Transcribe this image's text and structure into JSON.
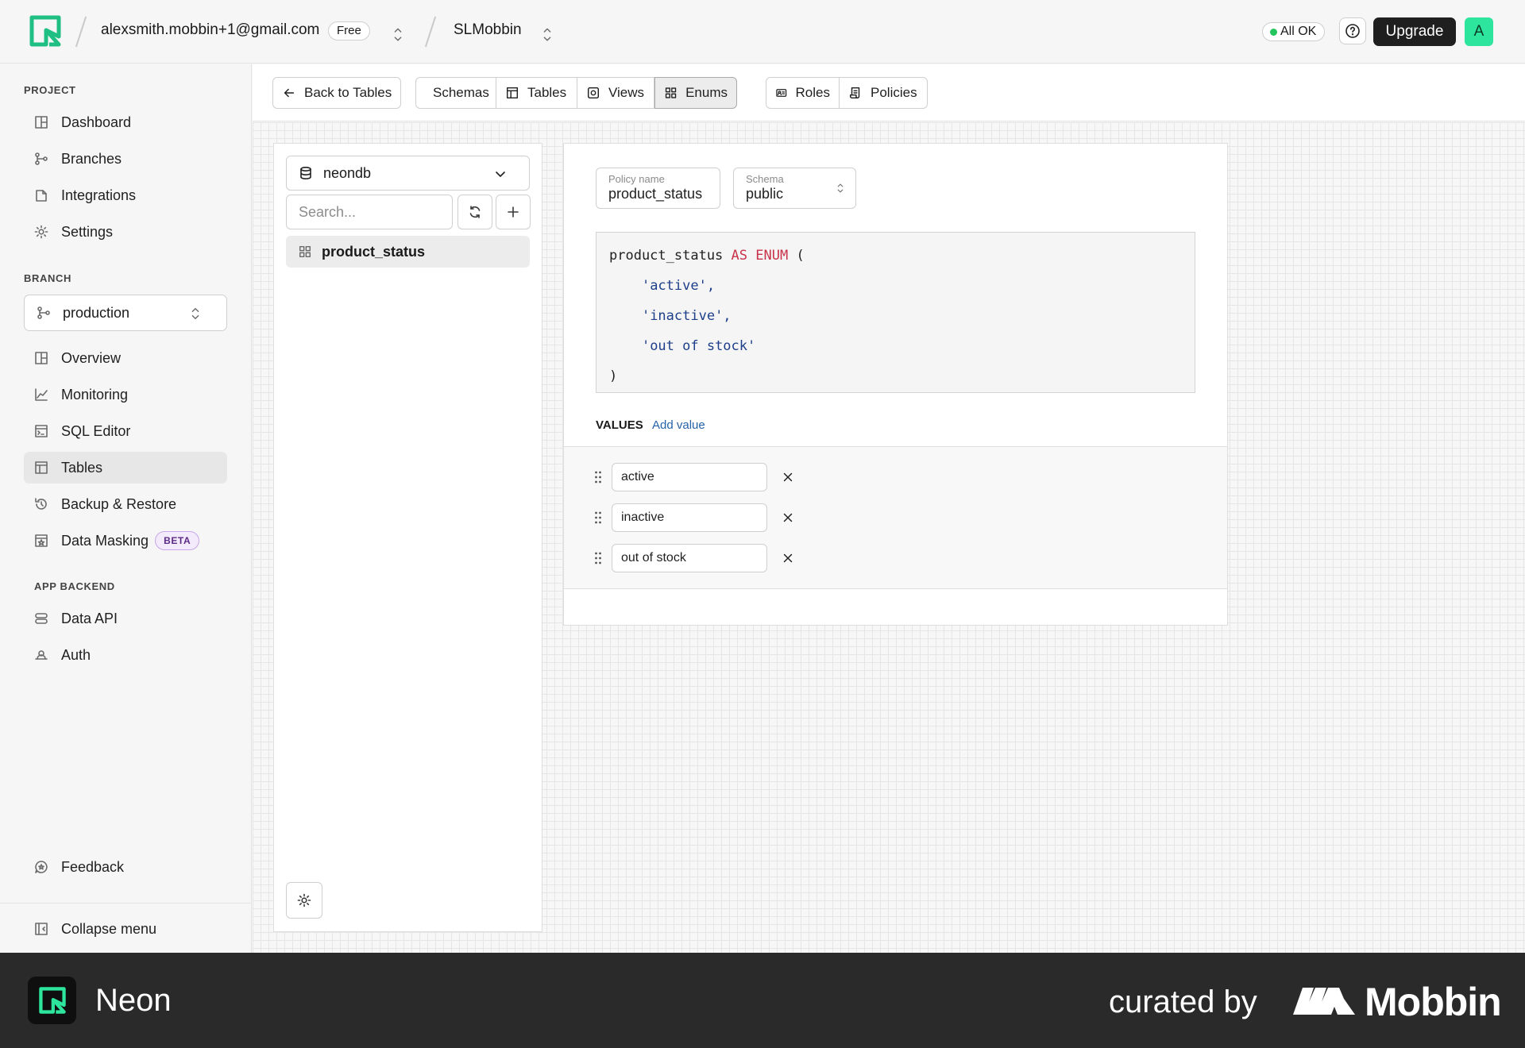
{
  "header": {
    "account_email": "alexsmith.mobbin+1@gmail.com",
    "plan": "Free",
    "project": "SLMobbin",
    "status": "All OK",
    "upgrade_label": "Upgrade",
    "avatar_initial": "A",
    "accent_color": "#22c55e"
  },
  "sidebar": {
    "project_label": "PROJECT",
    "project_items": [
      {
        "label": "Dashboard",
        "icon": "dashboard-icon"
      },
      {
        "label": "Branches",
        "icon": "branches-icon"
      },
      {
        "label": "Integrations",
        "icon": "integrations-icon"
      },
      {
        "label": "Settings",
        "icon": "gear-icon"
      }
    ],
    "branch_label": "BRANCH",
    "branch_selected": "production",
    "branch_items": [
      {
        "label": "Overview",
        "icon": "overview-icon"
      },
      {
        "label": "Monitoring",
        "icon": "monitoring-icon"
      },
      {
        "label": "SQL Editor",
        "icon": "sql-editor-icon"
      },
      {
        "label": "Tables",
        "icon": "tables-icon",
        "active": true
      },
      {
        "label": "Backup & Restore",
        "icon": "restore-icon"
      },
      {
        "label": "Data Masking",
        "icon": "data-masking-icon",
        "badge": "BETA"
      }
    ],
    "backend_label": "APP BACKEND",
    "backend_items": [
      {
        "label": "Data API",
        "icon": "data-api-icon"
      },
      {
        "label": "Auth",
        "icon": "auth-icon"
      }
    ],
    "feedback_label": "Feedback",
    "collapse_label": "Collapse menu"
  },
  "toolbar": {
    "back_label": "Back to Tables",
    "tabs": [
      "Schemas",
      "Tables",
      "Views",
      "Enums"
    ],
    "active_tab": "Enums",
    "security_tabs": [
      "Roles",
      "Policies"
    ]
  },
  "enum_list": {
    "database": "neondb",
    "search_placeholder": "Search...",
    "items": [
      "product_status"
    ]
  },
  "editor": {
    "name_label": "Policy name",
    "name_value": "product_status",
    "schema_label": "Schema",
    "schema_value": "public",
    "code": {
      "name": "product_status",
      "keywords": "AS ENUM",
      "open": "(",
      "values": [
        "'active',",
        "'inactive',",
        "'out of stock'"
      ],
      "close": ")"
    },
    "values_heading": "VALUES",
    "add_value_label": "Add value",
    "values": [
      "active",
      "inactive",
      "out of stock"
    ]
  },
  "footer": {
    "app_name": "Neon",
    "curated_by": "curated by",
    "brand": "Mobbin"
  }
}
